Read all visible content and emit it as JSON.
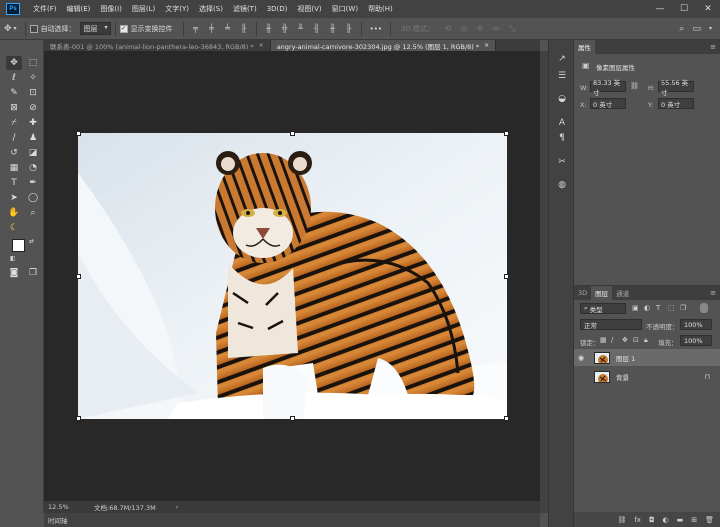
{
  "app": {
    "logo": "Ps"
  },
  "menu": [
    "文件(F)",
    "编辑(E)",
    "图像(I)",
    "图层(L)",
    "文字(Y)",
    "选择(S)",
    "滤镜(T)",
    "3D(D)",
    "视图(V)",
    "窗口(W)",
    "帮助(H)"
  ],
  "window_controls": {
    "minimize": "—",
    "maximize": "☐",
    "close": "✕"
  },
  "options": {
    "auto_select_label": "自动选择：",
    "auto_select_value": "图层",
    "show_transform_label": "显示变换控件",
    "mode_3d_label": "3D 模式：",
    "more": "•••"
  },
  "tabs": [
    {
      "label": "联系表-001 @ 100% (animal-lion-panthera-leo-36843, RGB/8) *",
      "close": "×",
      "active": false
    },
    {
      "label": "angry-animal-carnivore-302304.jpg @ 12.5% (图层 1, RGB/8) *",
      "close": "×",
      "active": true
    }
  ],
  "status": {
    "zoom": "12.5%",
    "doc_size": "文档:68.7M/137.3M",
    "arrow": "›"
  },
  "timeline": {
    "label": "时间轴"
  },
  "properties": {
    "tab": "属性",
    "header": "像素图层属性",
    "w_label": "W:",
    "w_value": "83.33 英寸",
    "h_label": "H:",
    "h_value": "55.56 英寸",
    "x_label": "X:",
    "x_value": "0 英寸",
    "y_label": "Y:",
    "y_value": "0 英寸"
  },
  "layers_panel": {
    "tabs": [
      "3D",
      "图层",
      "通道"
    ],
    "filter_label": "类型",
    "blend_mode": "正常",
    "opacity_label": "不透明度：",
    "opacity_value": "100%",
    "lock_label": "锁定：",
    "fill_label": "填充：",
    "fill_value": "100%",
    "layers": [
      {
        "name": "图层 1",
        "visible": true,
        "selected": true,
        "locked": false
      },
      {
        "name": "背景",
        "visible": false,
        "selected": false,
        "locked": true
      }
    ]
  },
  "colors": {
    "foreground": "#ffffff",
    "background": "#ffee00"
  }
}
